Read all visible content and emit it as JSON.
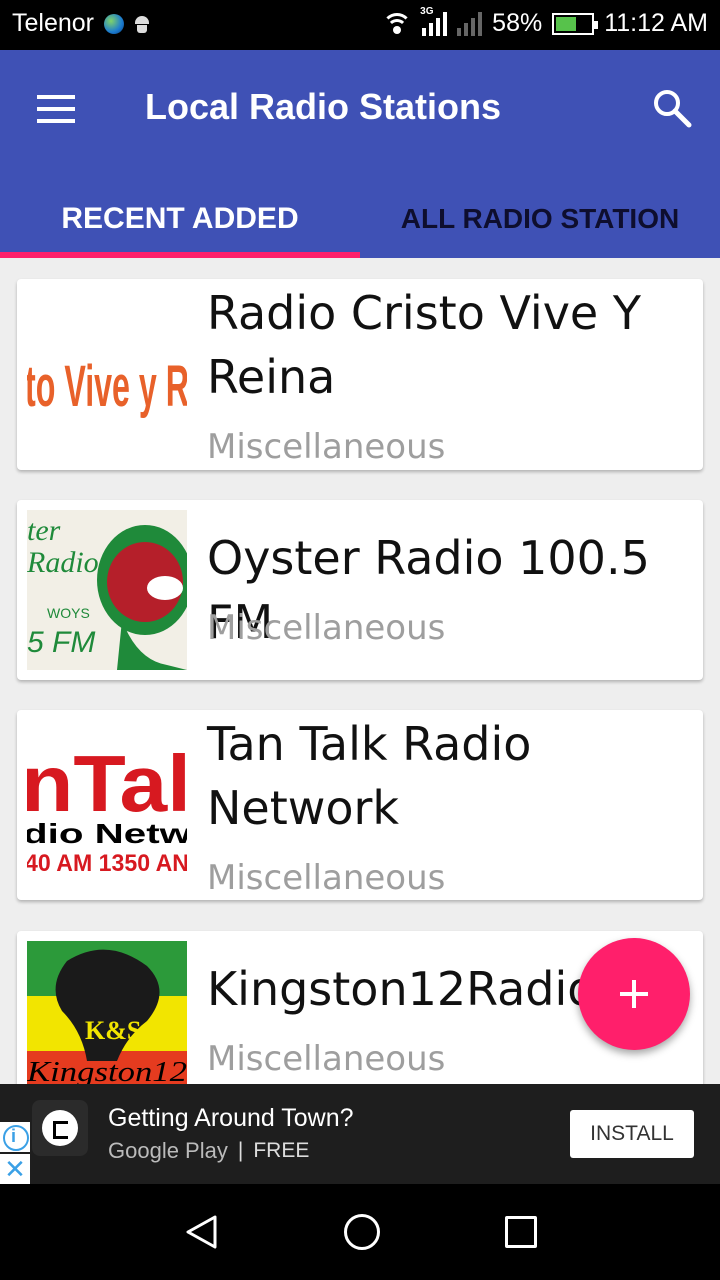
{
  "status_bar": {
    "carrier": "Telenor",
    "network_type": "3G",
    "battery": "58%",
    "battery_level": 0.58,
    "time": "11:12 AM"
  },
  "app_bar": {
    "title": "Local Radio Stations",
    "menu_icon": "hamburger-menu-icon",
    "search_icon": "search-icon",
    "color": "#3f51b5"
  },
  "tabs": [
    {
      "label": "RECENT ADDED",
      "active": true
    },
    {
      "label": "ALL RADIO STATION",
      "active": false
    }
  ],
  "accent_color": "#ff1f6b",
  "stations": [
    {
      "name_lines": [
        "Radio Cristo Vive Y",
        "Reina"
      ],
      "category": "Miscellaneous",
      "logo_text": "to Vive y R"
    },
    {
      "name_lines": [
        "Oyster Radio 100.5 FM"
      ],
      "category": "Miscellaneous",
      "logo_text_1": "ter",
      "logo_text_2": "Radio",
      "logo_text_3": "WOYS",
      "logo_text_4": "5 FM"
    },
    {
      "name_lines": [
        "Tan Talk Radio",
        "Network"
      ],
      "category": "Miscellaneous",
      "logo_text_1": "nTal",
      "logo_text_2": "dio Netw",
      "logo_text_3": "40 AM 1350 AN"
    },
    {
      "name_lines": [
        "Kingston12Radio"
      ],
      "category": "Miscellaneous",
      "logo_text_1": "K&S",
      "logo_text_2": "Kingston12"
    }
  ],
  "fab_icon": "plus-icon",
  "ad": {
    "headline": "Getting Around Town?",
    "store": "Google Play",
    "divider": "|",
    "price": "FREE",
    "install_label": "INSTALL",
    "close_label": "✕"
  }
}
